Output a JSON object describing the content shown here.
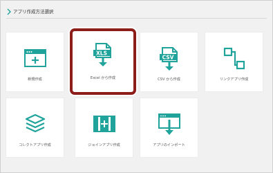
{
  "header": {
    "title": "アプリ作成方法選択"
  },
  "colors": {
    "accent": "#1fa39b",
    "selection_border": "#8d1d18"
  },
  "tiles": [
    {
      "label": "新規作成",
      "icon": "new-app-icon"
    },
    {
      "label": "Excel から作成",
      "icon": "xls-file-icon",
      "badge": "XLS",
      "selected": true
    },
    {
      "label": "CSV から作成",
      "icon": "csv-file-icon",
      "badge": "CSV"
    },
    {
      "label": "リンクアプリ作成",
      "icon": "link-app-icon"
    },
    {
      "label": "コレクトアプリ作成",
      "icon": "layers-icon"
    },
    {
      "label": "ジョインアプリ作成",
      "icon": "join-app-icon"
    },
    {
      "label": "アプリのインポート",
      "icon": "import-app-icon"
    }
  ]
}
